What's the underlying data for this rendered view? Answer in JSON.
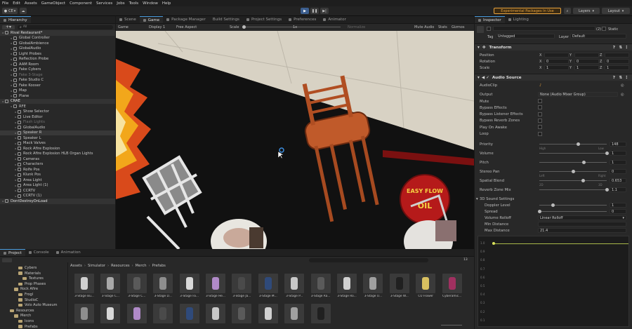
{
  "menu": [
    "File",
    "Edit",
    "Assets",
    "GameObject",
    "Component",
    "Services",
    "Jobs",
    "Tools",
    "Window",
    "Help"
  ],
  "toolbar": {
    "account": "CE",
    "experimental": "Experimental Packages In Use",
    "layers": "Layers",
    "layout": "Layout"
  },
  "tabs": {
    "hierarchy": "Hierarchy",
    "scene": "Scene",
    "game": "Game",
    "package_manager": "Package Manager",
    "build_settings": "Build Settings",
    "project_settings": "Project Settings",
    "preferences": "Preferences",
    "animator": "Animator",
    "inspector": "Inspector",
    "lighting": "Lighting",
    "project": "Project",
    "console": "Console",
    "animation": "Animation"
  },
  "hierarchy": {
    "search_label": "All",
    "rows": [
      {
        "label": "Rival Restaurant*",
        "indent": 0,
        "kind": "scene"
      },
      {
        "label": "Global Controller",
        "indent": 2,
        "kind": "item"
      },
      {
        "label": "GlobalAmbience",
        "indent": 2,
        "kind": "item"
      },
      {
        "label": "GlobalAudio",
        "indent": 2,
        "kind": "item"
      },
      {
        "label": "Light Probes",
        "indent": 2,
        "kind": "item"
      },
      {
        "label": "Reflection Probe",
        "indent": 2,
        "kind": "item"
      },
      {
        "label": "AAM Room",
        "indent": 2,
        "kind": "item"
      },
      {
        "label": "Fake Cybers",
        "indent": 2,
        "kind": "item"
      },
      {
        "label": "Fake 3-Stage",
        "indent": 2,
        "kind": "dim"
      },
      {
        "label": "Fake Studio C",
        "indent": 2,
        "kind": "item"
      },
      {
        "label": "Fake Kooser",
        "indent": 2,
        "kind": "item"
      },
      {
        "label": "Map",
        "indent": 2,
        "kind": "item"
      },
      {
        "label": "Plane",
        "indent": 2,
        "kind": "item"
      },
      {
        "label": "CRAE",
        "indent": 0,
        "kind": "scene"
      },
      {
        "label": "RFE",
        "indent": 2,
        "kind": "item"
      },
      {
        "label": "Show Selector",
        "indent": 3,
        "kind": "item"
      },
      {
        "label": "Live Editor",
        "indent": 3,
        "kind": "item"
      },
      {
        "label": "Flash Lights",
        "indent": 3,
        "kind": "dim"
      },
      {
        "label": "GlobalAudio",
        "indent": 3,
        "kind": "item"
      },
      {
        "label": "Speaker R",
        "indent": 3,
        "kind": "hl"
      },
      {
        "label": "Speaker L",
        "indent": 3,
        "kind": "item"
      },
      {
        "label": "Mack Valves",
        "indent": 3,
        "kind": "item"
      },
      {
        "label": "Rock Afire Explosion",
        "indent": 3,
        "kind": "item"
      },
      {
        "label": "Rock Afire Explosion HLB Organ Lights",
        "indent": 3,
        "kind": "item"
      },
      {
        "label": "Cameras",
        "indent": 3,
        "kind": "item"
      },
      {
        "label": "Characters",
        "indent": 3,
        "kind": "item"
      },
      {
        "label": "Rolfe Pos",
        "indent": 3,
        "kind": "item"
      },
      {
        "label": "Klunk Pos",
        "indent": 3,
        "kind": "item"
      },
      {
        "label": "Area Light",
        "indent": 3,
        "kind": "item"
      },
      {
        "label": "Area Light (1)",
        "indent": 3,
        "kind": "item"
      },
      {
        "label": "CCRTV",
        "indent": 3,
        "kind": "item"
      },
      {
        "label": "CCRTV (1)",
        "indent": 3,
        "kind": "item"
      },
      {
        "label": "DontDestroyOnLoad",
        "indent": 0,
        "kind": "scene"
      }
    ]
  },
  "game_toolbar": {
    "mode": "Game",
    "display": "Display 1",
    "aspect": "Free Aspect",
    "scale_label": "Scale",
    "scale_value": "1x",
    "normalize": "Normalize",
    "mute_audio": "Mute Audio",
    "stats": "Stats",
    "gizmos": "Gizmos"
  },
  "scene_sign": {
    "line1": "EASY FLOW",
    "line2": "OIL"
  },
  "inspector": {
    "layer_count": "(2)",
    "static_label": "Static",
    "tag_label": "Tag",
    "tag_value": "Untagged",
    "layer_label": "Layer",
    "layer_value": "Default",
    "transform": {
      "title": "Transform",
      "rows": [
        {
          "label": "Position",
          "x": "",
          "y": "",
          "z": ""
        },
        {
          "label": "Rotation",
          "x": "0",
          "y": "0",
          "z": "0"
        },
        {
          "label": "Scale",
          "x": "1",
          "y": "1",
          "z": "1"
        }
      ]
    },
    "audio_source": {
      "title": "Audio Source",
      "audio_clip_label": "AudioClip",
      "output_label": "Output",
      "output_value": "None (Audio Mixer Group)",
      "checks": [
        "Mute",
        "Bypass Effects",
        "Bypass Listener Effects",
        "Bypass Reverb Zones",
        "Play On Awake",
        "Loop"
      ],
      "priority": {
        "label": "Priority",
        "value": "148",
        "fraction": 0.58,
        "left": "High",
        "right": "Low"
      },
      "volume": {
        "label": "Volume",
        "value": "1",
        "fraction": 1.0
      },
      "pitch": {
        "label": "Pitch",
        "value": "1",
        "fraction": 0.66
      },
      "stereo_pan": {
        "label": "Stereo Pan",
        "value": "0",
        "fraction": 0.5,
        "left": "Left",
        "right": "Right"
      },
      "spatial_blend": {
        "label": "Spatial Blend",
        "value": "0.653",
        "fraction": 0.65,
        "left": "2D",
        "right": "3D"
      },
      "reverb": {
        "label": "Reverb Zone Mix",
        "value": "1.1",
        "fraction": 1.0
      },
      "sound3d": {
        "label": "3D Sound Settings",
        "doppler": {
          "label": "Doppler Level",
          "value": "1",
          "fraction": 0.2
        },
        "spread": {
          "label": "Spread",
          "value": "0",
          "fraction": 0.0
        },
        "rolloff": {
          "label": "Volume Rolloff",
          "value": "Linear Rolloff"
        },
        "min_distance": {
          "label": "Min Distance",
          "value": ""
        },
        "max_distance": {
          "label": "Max Distance",
          "value": "21.4"
        }
      }
    },
    "graph_ticks": [
      "1.0",
      "0.9",
      "0.8",
      "0.7",
      "0.6",
      "0.5",
      "0.4",
      "0.3",
      "0.2",
      "0.1"
    ]
  },
  "project": {
    "count": "13",
    "tree": [
      {
        "label": "Cybers",
        "indent": 2
      },
      {
        "label": "Materials",
        "indent": 2
      },
      {
        "label": "Textures",
        "indent": 3
      },
      {
        "label": "Prop Phases",
        "indent": 2
      },
      {
        "label": "Rock Afire",
        "indent": 1
      },
      {
        "label": "Frogl",
        "indent": 2
      },
      {
        "label": "StudioC",
        "indent": 2
      },
      {
        "label": "Volo Auto Museum",
        "indent": 2
      },
      {
        "label": "Resources",
        "indent": 0
      },
      {
        "label": "Merch",
        "indent": 1
      },
      {
        "label": "Icons",
        "indent": 2
      },
      {
        "label": "Prefabs",
        "indent": 2
      }
    ],
    "breadcrumb": [
      "Assets",
      "Simulator",
      "Resources",
      "Merch",
      "Prefabs"
    ],
    "assets_row1": [
      "3-Stage Bu...",
      "3-Stage C...",
      "3-Stage C...",
      "3-Stage D...",
      "3-Stage Fa...",
      "3-Stage He...",
      "3-Stage Ja...",
      "3-Stage M...",
      "3-Stage P...",
      "3-Stage Ra...",
      "3-Stage Ro...",
      "3-Stage U...",
      "3-Stage W...",
      "CU Flower",
      "Cyberamic..."
    ],
    "assets_row2_count": 10
  }
}
